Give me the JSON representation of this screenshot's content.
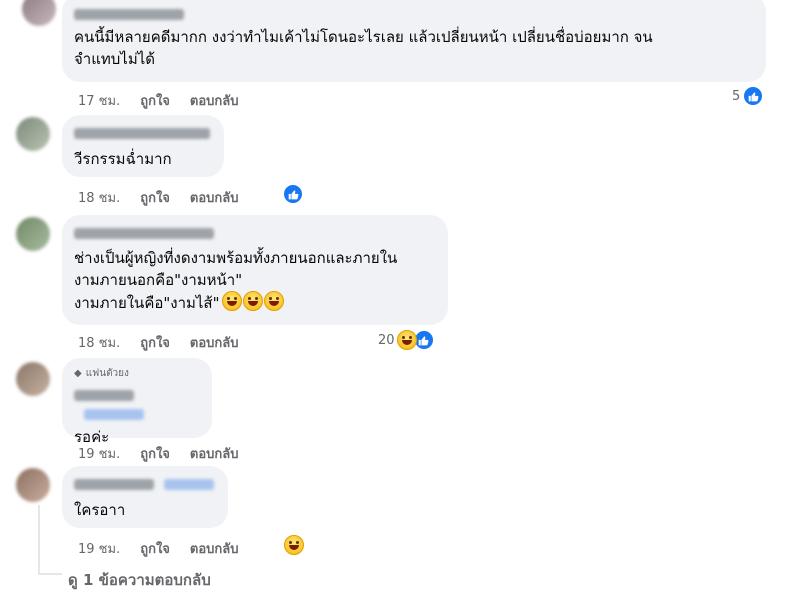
{
  "comments": [
    {
      "text": "คนนี้มีหลายคดีมากก งงว่าทำไมเค้าไม่โดนอะไรเลย แล้วเปลี่ยนหน้า เปลี่ยนชื่อบ่อยมาก จน\nจำแทบไม่ได้",
      "time": "17 ชม.",
      "like_label": "ถูกใจ",
      "reply_label": "ตอบกลับ",
      "reaction_count": "5",
      "reactions": [
        "like-icon"
      ]
    },
    {
      "text": "วีรกรรมฉ่ำมาก",
      "time": "18 ชม.",
      "like_label": "ถูกใจ",
      "reply_label": "ตอบกลับ",
      "reaction_count": "",
      "reactions": [
        "like-icon"
      ]
    },
    {
      "text": "ช่างเป็นผู้หญิงที่งดงามพร้อมทั้งภายนอกและภายใน\nงามภายนอกคือ\"งามหน้า\"\nงามภายในคือ\"งามไส้\"",
      "time": "18 ชม.",
      "like_label": "ถูกใจ",
      "reply_label": "ตอบกลับ",
      "reaction_count": "20",
      "reactions": [
        "haha-icon",
        "like-icon"
      ]
    },
    {
      "badge": "แฟนตัวยง",
      "text": "รอค่ะ",
      "time": "19 ชม.",
      "like_label": "ถูกใจ",
      "reply_label": "ตอบกลับ",
      "reaction_count": "",
      "reactions": []
    },
    {
      "text": "ใครอาา",
      "time": "19 ชม.",
      "like_label": "ถูกใจ",
      "reply_label": "ตอบกลับ",
      "reaction_count": "",
      "reactions": [
        "haha-icon"
      ]
    }
  ],
  "view_replies": "ดู 1 ข้อความตอบกลับ",
  "colors": {
    "bubble": "#f0f2f5",
    "like_blue": "#1877f2",
    "meta_gray": "#65676b"
  }
}
